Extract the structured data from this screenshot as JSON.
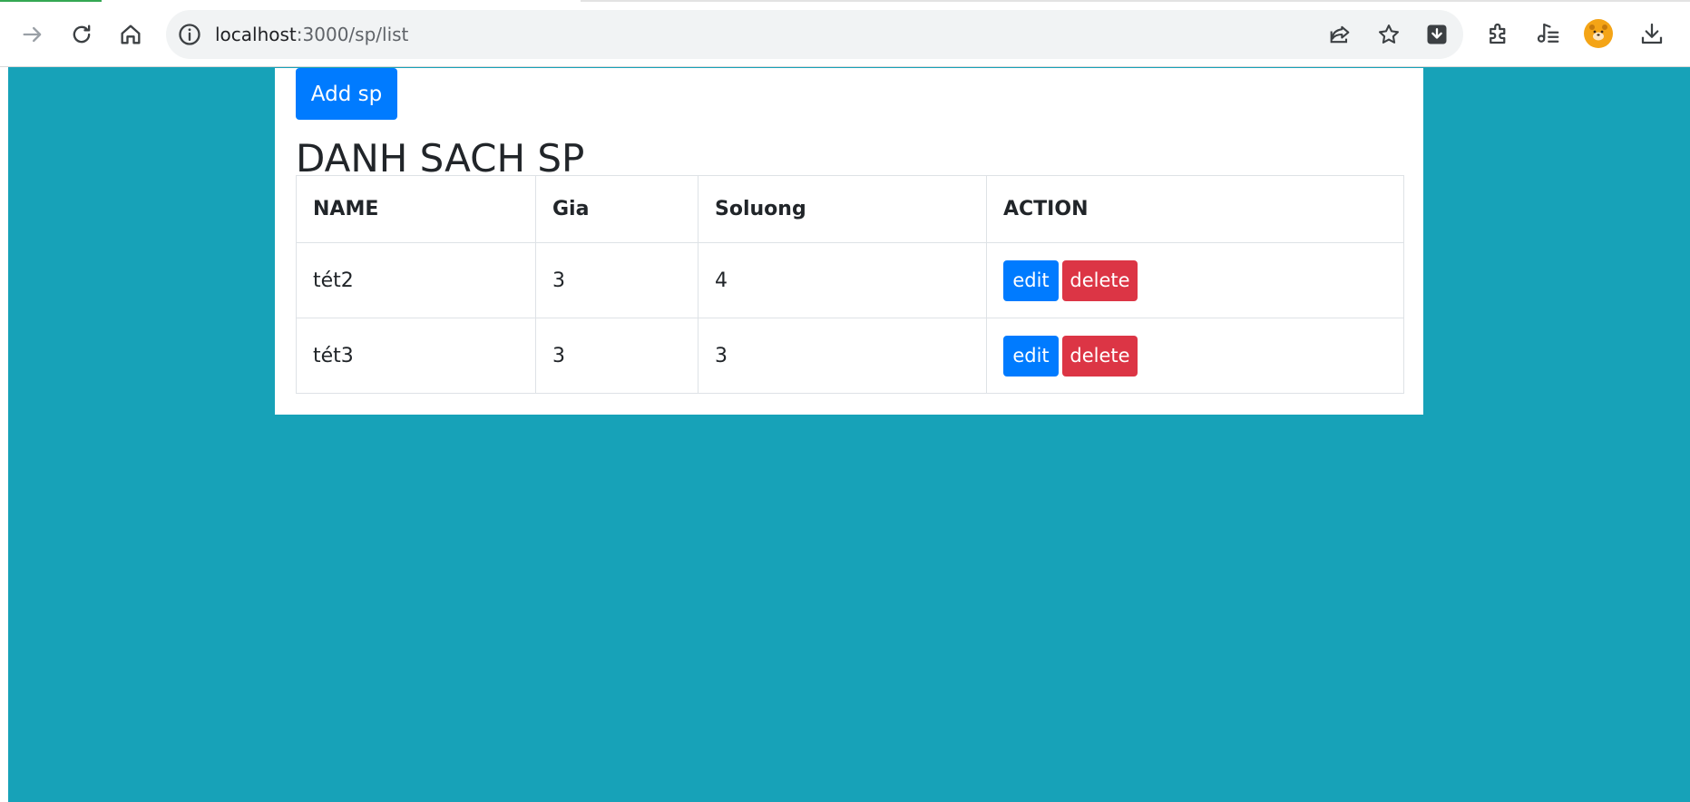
{
  "browser": {
    "url_host": "localhost",
    "url_path": ":3000/sp/list"
  },
  "page": {
    "add_button_label": "Add sp",
    "title": "DANH SACH SP",
    "table": {
      "headers": [
        "NAME",
        "Gia",
        "Soluong",
        "ACTION"
      ],
      "rows": [
        {
          "name": "tét2",
          "gia": "3",
          "soluong": "4",
          "edit_label": "edit",
          "delete_label": "delete"
        },
        {
          "name": "tét3",
          "gia": "3",
          "soluong": "3",
          "edit_label": "edit",
          "delete_label": "delete"
        }
      ]
    }
  },
  "colors": {
    "page_background": "#17a2b8",
    "primary": "#007bff",
    "danger": "#dc3545",
    "avatar": "#f4a416"
  },
  "icons": [
    "forward-icon",
    "reload-icon",
    "home-icon",
    "site-info-icon",
    "share-icon",
    "bookmark-star-icon",
    "download-extension-icon",
    "extensions-puzzle-icon",
    "media-control-icon",
    "profile-avatar-icon",
    "downloads-icon"
  ]
}
